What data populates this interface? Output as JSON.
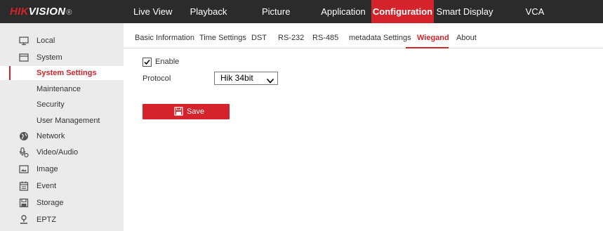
{
  "brand": {
    "logo_red": "HIK",
    "logo_white": "VISION",
    "logo_reg": "®"
  },
  "nav": {
    "items": [
      {
        "label": "Live View"
      },
      {
        "label": "Playback"
      },
      {
        "label": "Picture"
      },
      {
        "label": "Application"
      },
      {
        "label": "Configuration",
        "active": true
      },
      {
        "label": "Smart Display"
      },
      {
        "label": "VCA"
      }
    ]
  },
  "sidebar": {
    "items": [
      {
        "label": "Local",
        "icon": "monitor-icon"
      },
      {
        "label": "System",
        "icon": "system-icon"
      },
      {
        "label": "System Settings",
        "active": true
      },
      {
        "label": "Maintenance"
      },
      {
        "label": "Security"
      },
      {
        "label": "User Management"
      },
      {
        "label": "Network",
        "icon": "globe-icon"
      },
      {
        "label": "Video/Audio",
        "icon": "video-audio-icon"
      },
      {
        "label": "Image",
        "icon": "image-icon"
      },
      {
        "label": "Event",
        "icon": "calendar-icon"
      },
      {
        "label": "Storage",
        "icon": "storage-icon"
      },
      {
        "label": "EPTZ",
        "icon": "person-icon"
      }
    ]
  },
  "tabs": {
    "items": [
      {
        "label": "Basic Information"
      },
      {
        "label": "Time Settings"
      },
      {
        "label": "DST"
      },
      {
        "label": "RS-232"
      },
      {
        "label": "RS-485"
      },
      {
        "label": "metadata Settings"
      },
      {
        "label": "Wiegand",
        "active": true
      },
      {
        "label": "About"
      }
    ]
  },
  "form": {
    "enable_label": "Enable",
    "enable_checked": true,
    "protocol_label": "Protocol",
    "protocol_value": "Hik 34bit",
    "save_label": "Save"
  },
  "colors": {
    "accent": "#d4232b",
    "topbar": "#2b2b2b",
    "sidebar": "#ebebeb"
  }
}
